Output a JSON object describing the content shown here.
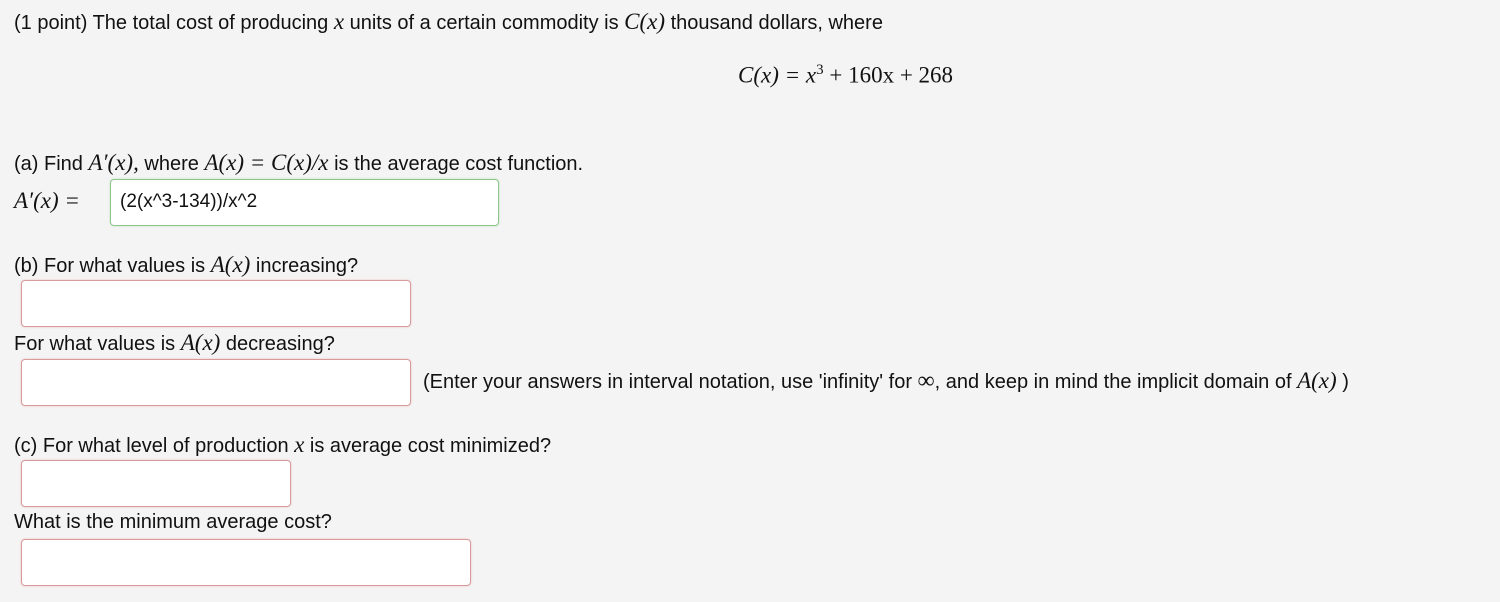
{
  "problem": {
    "intro_pre": "(1 point) The total cost of producing",
    "intro_var": "x",
    "intro_mid": "units of a certain commodity is",
    "intro_func": "C(x)",
    "intro_post": "thousand dollars, where",
    "equation": {
      "lhs": "C(x) = x",
      "exponent": "3",
      "rhs": "+ 160x + 268"
    }
  },
  "part_a": {
    "pre": "(a) Find",
    "deriv": "A′(x),",
    "where": "where",
    "def": "A(x) = C(x)/x",
    "post": "is the average cost function.",
    "answer_label": "A′(x) =",
    "answer_value": "(2(x^3-134))/x^2"
  },
  "part_b": {
    "q1_pre": "(b) For what values is",
    "q1_func": "A(x)",
    "q1_post": "increasing?",
    "q1_value": "",
    "q2_pre": "For what values is",
    "q2_func": "A(x)",
    "q2_post": "decreasing?",
    "q2_value": "",
    "hint_pre": "(Enter your answers in interval notation, use 'infinity' for",
    "hint_inf": "∞",
    "hint_mid": ", and keep in mind the implicit domain of",
    "hint_func": "A(x)",
    "hint_post": ")"
  },
  "part_c": {
    "q1_pre": "(c) For what level of production",
    "q1_var": "x",
    "q1_post": "is average cost minimized?",
    "q1_value": "",
    "q2": "What is the minimum average cost?",
    "q2_value": ""
  }
}
